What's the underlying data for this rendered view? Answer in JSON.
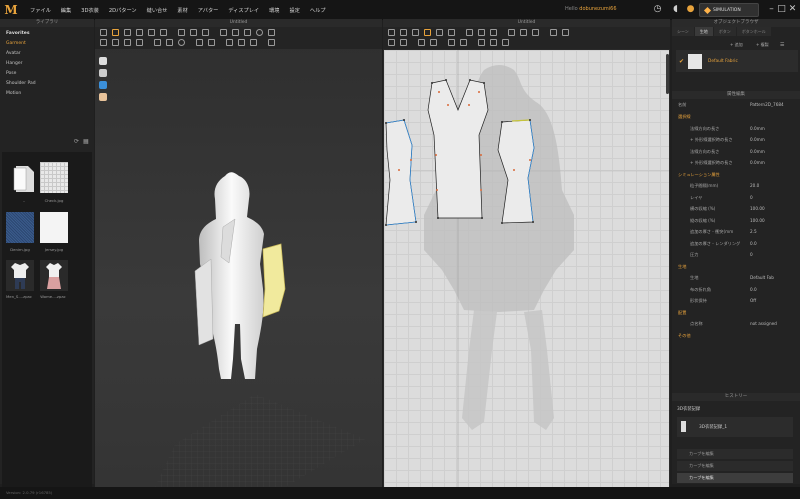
{
  "app": {
    "logo": "M"
  },
  "menu": [
    "ファイル",
    "編集",
    "3D衣装",
    "2Dパターン",
    "縫い合せ",
    "素材",
    "アバター",
    "ディスプレイ",
    "環境",
    "設定",
    "ヘルプ"
  ],
  "user": {
    "label": "Hello",
    "name": "dobunezumi66"
  },
  "simulation_label": "SIMULATION",
  "library": {
    "title": "ライブラリ",
    "tree": [
      "Favorites",
      "Garment",
      "Avatar",
      "Hanger",
      "Pose",
      "Shoulder Pad",
      "Motion"
    ],
    "files": [
      "..",
      "Check.jpg",
      "Denim.jpg",
      "Jersey.jpg",
      "Men_S....zpac",
      "Wome....zpac"
    ]
  },
  "viewport3d": {
    "title": "Untitled"
  },
  "viewport2d": {
    "title": "Untitled"
  },
  "object_browser": {
    "title": "オブジェクトブラウザ",
    "tabs": [
      "シーン",
      "生地",
      "ボタン",
      "ボタンホール"
    ],
    "add_label": "+ 追加",
    "copy_label": "+ 複製",
    "fabric_name": "Default Fabric"
  },
  "property_editor": {
    "title": "属性編集",
    "name_label": "名前",
    "name_value": "Pattern2D_7684",
    "rows": [
      {
        "key": "選択線",
        "value": "",
        "section": true
      },
      {
        "key": "法線方向の長さ",
        "value": "0.0mm"
      },
      {
        "key": "+ 外形線選択時の長さ",
        "value": "0.0mm"
      },
      {
        "key": "法線方向の長さ",
        "value": "0.0mm"
      },
      {
        "key": "+ 外形線選択時の長さ",
        "value": "0.0mm"
      },
      {
        "key": "シミュレーション属性",
        "value": "",
        "section": true
      },
      {
        "key": "粒子間隔(mm)",
        "value": "20.0"
      },
      {
        "key": "レイヤ",
        "value": "0"
      },
      {
        "key": "横の収縮 (%)",
        "value": "100.00"
      },
      {
        "key": "縦の収縮 (%)",
        "value": "100.00"
      },
      {
        "key": "追加の厚さ - 衝突(mm",
        "value": "2.5"
      },
      {
        "key": "追加の厚さ - レンダリング",
        "value": "0.0"
      },
      {
        "key": "圧力",
        "value": "0"
      },
      {
        "key": "生地",
        "value": "",
        "section": true
      },
      {
        "key": "生地",
        "value": "Default Fab"
      },
      {
        "key": "布の折れ角",
        "value": "0.0"
      },
      {
        "key": "形状保持",
        "value": "Off"
      },
      {
        "key": "配置",
        "value": "",
        "section": true
      },
      {
        "key": "点名称",
        "value": "not assigned"
      },
      {
        "key": "その他",
        "value": "",
        "section": true
      }
    ]
  },
  "history": {
    "title": "ヒストリー",
    "section": "3D衣装記録",
    "item": "3D衣装記録_1",
    "rows": [
      "カーブを編集",
      "カーブを編集",
      "カーブを編集"
    ]
  },
  "status": "Version: 2.0.79     (r16785)"
}
